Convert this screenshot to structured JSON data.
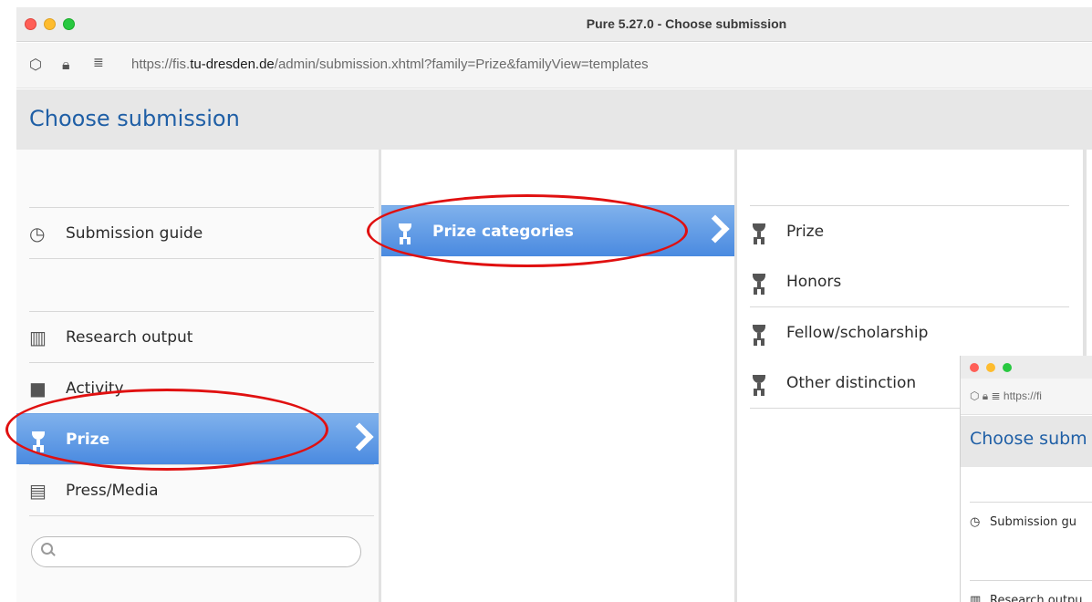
{
  "window": {
    "title": "Pure 5.27.0 - Choose submission"
  },
  "url": {
    "prefix": "https://fis.",
    "host": "tu-dresden.de",
    "path": "/admin/submission.xhtml?family=Prize&familyView=templates"
  },
  "page": {
    "title": "Choose submission"
  },
  "left_menu": {
    "guide": "Submission guide",
    "research": "Research output",
    "activity": "Activity",
    "prize": "Prize",
    "press": "Press/Media"
  },
  "middle_menu": {
    "category": "Prize categories"
  },
  "right_menu": [
    "Prize",
    "Honors",
    "Fellow/scholarship",
    "Other distinction"
  ],
  "search": {
    "placeholder": ""
  },
  "second_window": {
    "url": "https://fi",
    "title": "Choose subm",
    "guide": "Submission gu",
    "research": "Research outpu"
  },
  "colors": {
    "accent": "#4a8ae0",
    "title_blue": "#1f5fa6",
    "annotation": "#e01010"
  }
}
